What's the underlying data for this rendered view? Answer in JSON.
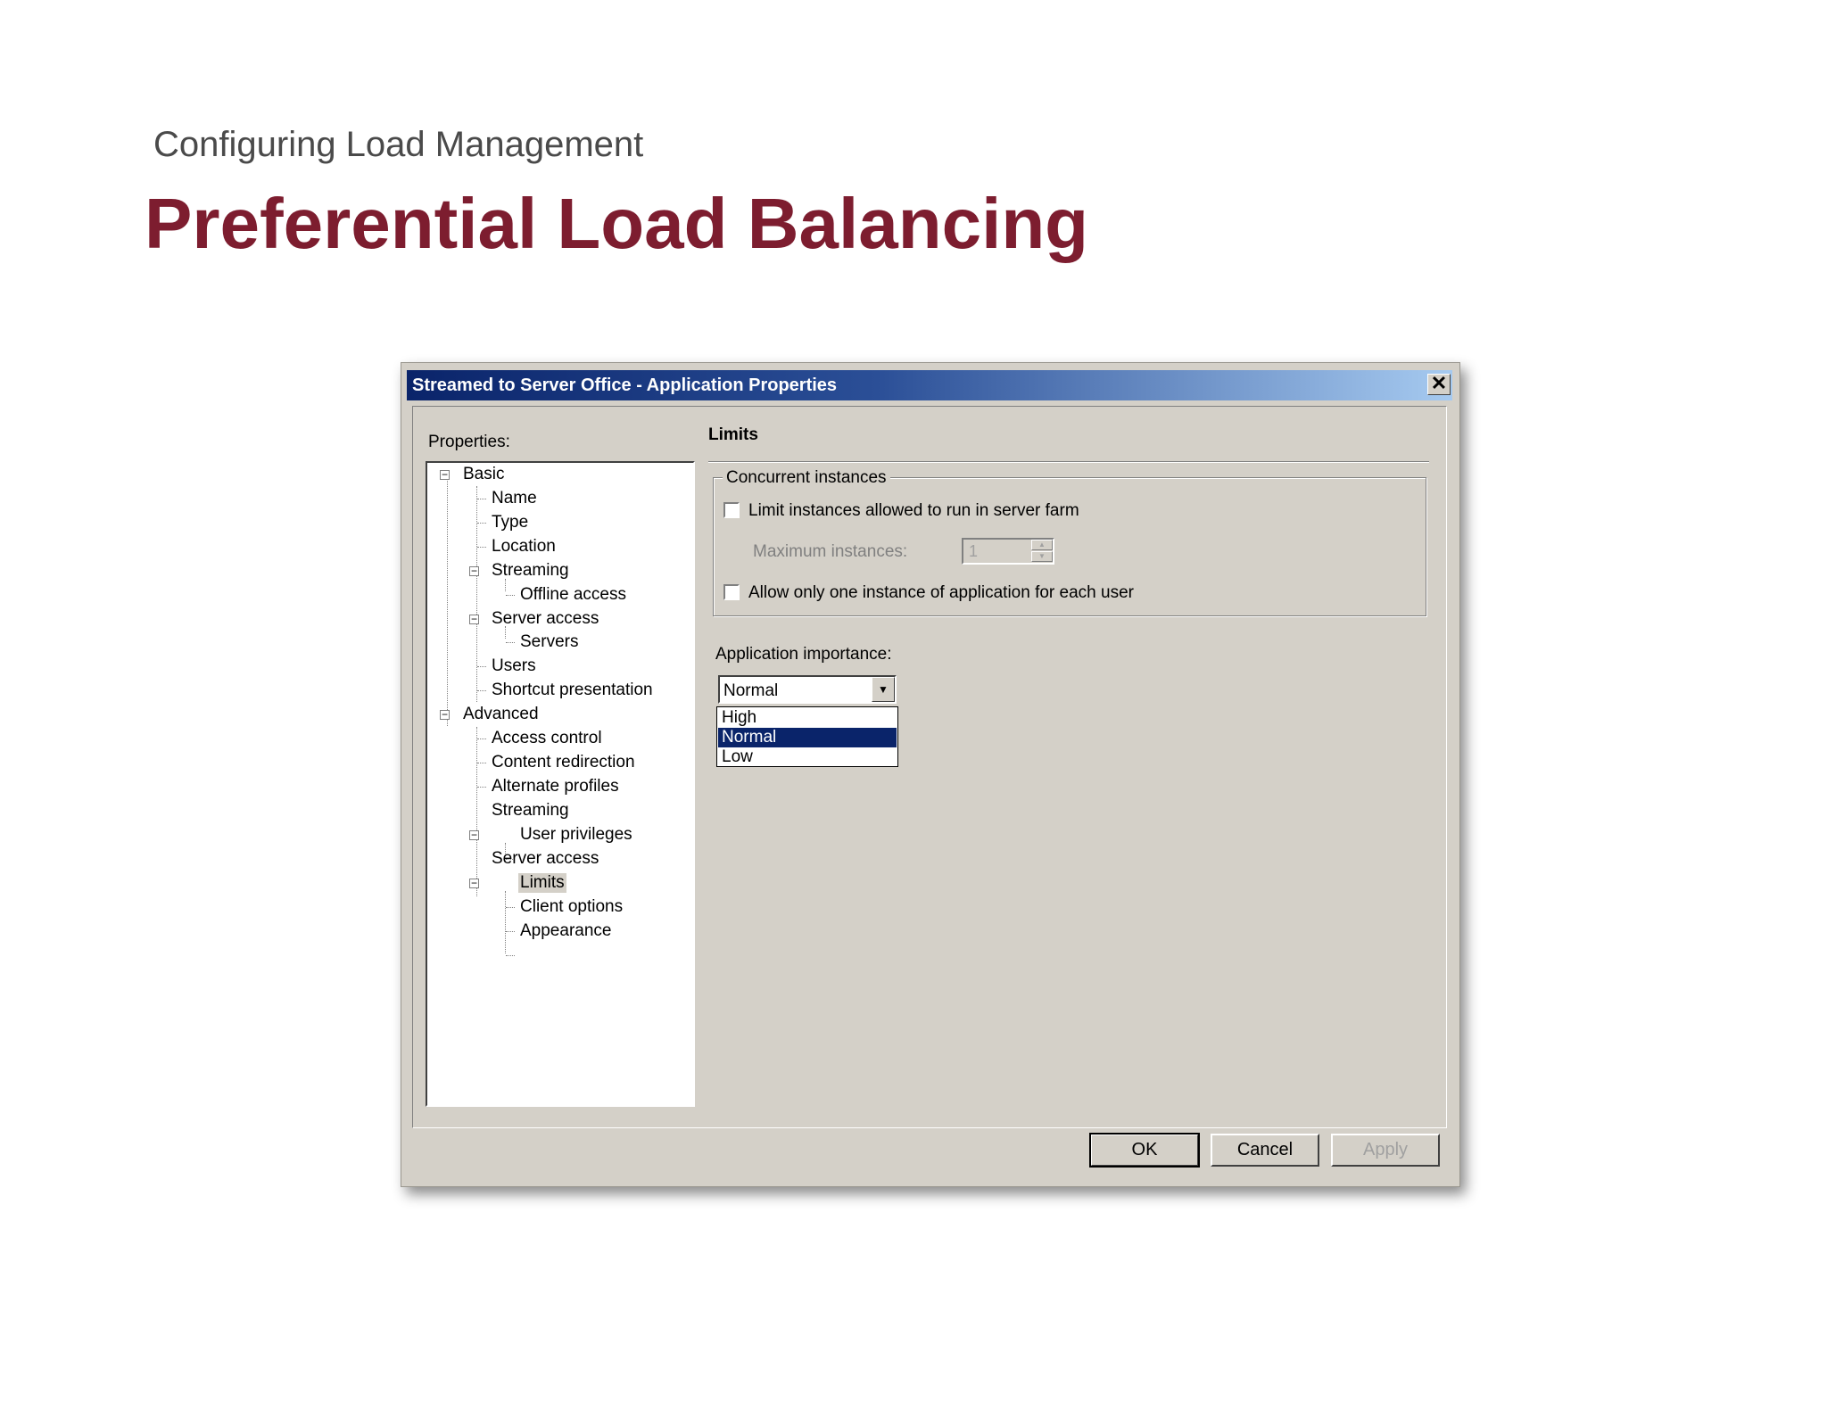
{
  "slide": {
    "subtitle": "Configuring Load Management",
    "title": "Preferential Load Balancing"
  },
  "dialog": {
    "title": "Streamed to Server Office - Application Properties",
    "close_glyph": "✕",
    "properties_label": "Properties:",
    "tree": {
      "basic": "Basic",
      "name": "Name",
      "type": "Type",
      "location": "Location",
      "streaming": "Streaming",
      "offline_access": "Offline access",
      "server_access": "Server access",
      "servers": "Servers",
      "users": "Users",
      "shortcut_presentation": "Shortcut presentation",
      "advanced": "Advanced",
      "access_control": "Access control",
      "content_redirection": "Content redirection",
      "alternate_profiles": "Alternate profiles",
      "adv_streaming": "Streaming",
      "user_privileges": "User privileges",
      "adv_server_access": "Server access",
      "limits": "Limits",
      "client_options": "Client options",
      "appearance": "Appearance"
    },
    "section_heading": "Limits",
    "concurrent": {
      "group_label": "Concurrent instances",
      "limit_label": "Limit instances allowed to run in server farm",
      "limit_checked": false,
      "max_label": "Maximum instances:",
      "max_value": "1",
      "one_instance_label": "Allow only one instance of application for each user",
      "one_instance_checked": false
    },
    "importance": {
      "label": "Application importance:",
      "selected": "Normal",
      "options": [
        "High",
        "Normal",
        "Low"
      ]
    },
    "buttons": {
      "ok": "OK",
      "cancel": "Cancel",
      "apply": "Apply"
    }
  }
}
